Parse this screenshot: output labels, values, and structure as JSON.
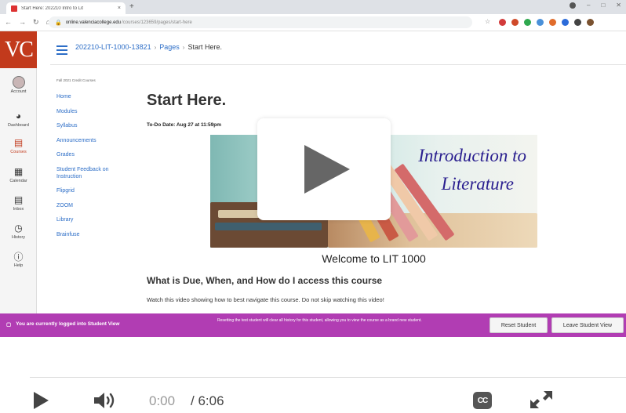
{
  "browser": {
    "tab_title": "Start Here: 202210 Intro to Lit",
    "tab_close": "×",
    "new_tab": "+",
    "url_host": "online.valenciacollege.edu",
    "url_path": "/courses/123659/pages/start-here"
  },
  "gnav": {
    "logo": "VC",
    "items": [
      {
        "label": "Account",
        "icon": "avatar-icon"
      },
      {
        "label": "Dashboard",
        "icon": "dashboard-icon"
      },
      {
        "label": "Courses",
        "icon": "book-icon",
        "active": true
      },
      {
        "label": "Calendar",
        "icon": "calendar-icon"
      },
      {
        "label": "Inbox",
        "icon": "inbox-icon"
      },
      {
        "label": "History",
        "icon": "clock-icon"
      },
      {
        "label": "Help",
        "icon": "help-icon"
      }
    ]
  },
  "breadcrumb": {
    "course": "202210-LIT-1000-13821",
    "sep": "›",
    "section": "Pages",
    "current": "Start Here."
  },
  "course_nav": {
    "term": "Fall 2021 Credit Courses",
    "links": [
      "Home",
      "Modules",
      "Syllabus",
      "Announcements",
      "Grades",
      "Student Feedback on Instruction",
      "Flipgrid",
      "ZOOM",
      "Library",
      "Brainfuse"
    ]
  },
  "page": {
    "title": "Start Here.",
    "todo": "To-Do Date: Aug 27 at 11:59pm",
    "banner_line1": "Introduction to",
    "banner_line2": "Literature",
    "welcome": "Welcome to LIT 1000",
    "section_heading": "What is Due, When, and How do I access this course",
    "section_text": "Watch this video showing how to best navigate this course. Do not skip watching this video!"
  },
  "student_view": {
    "label": "You are currently logged into Student View",
    "note": "Resetting the test student will clear all history for this student, allowing you to view the course as a brand new student.",
    "reset_button": "Reset Student",
    "leave_button": "Leave Student View"
  },
  "player": {
    "current_time": "0:00",
    "duration": "/ 6:06",
    "cc_label": "CC",
    "progress": 0
  },
  "colors": {
    "logo": "#c23a1c",
    "link": "#2d6ec7",
    "student_bar": "#b13db3",
    "banner_text": "#2a1f8f"
  }
}
